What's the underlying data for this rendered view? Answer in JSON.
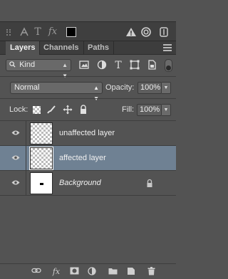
{
  "toolstrip": {
    "icons": [
      "type-warp-icon",
      "type-icon",
      "fx-icon",
      "color-swatch",
      "warning-icon",
      "link-layers-icon",
      "vertical-scroll-icon"
    ],
    "type_glyph": "T",
    "fx_glyph": "fx"
  },
  "tabs": [
    {
      "label": "Layers",
      "active": true
    },
    {
      "label": "Channels",
      "active": false
    },
    {
      "label": "Paths",
      "active": false
    }
  ],
  "filter": {
    "kind_label": "Kind",
    "icons": [
      "pixel-filter-icon",
      "adjustment-filter-icon",
      "type-filter-icon",
      "shape-filter-icon",
      "smart-object-filter-icon"
    ],
    "type_glyph": "T"
  },
  "blend": {
    "mode": "Normal",
    "opacity_label": "Opacity:",
    "opacity_value": "100%"
  },
  "lock": {
    "label": "Lock:",
    "fill_label": "Fill:",
    "fill_value": "100%"
  },
  "layers": [
    {
      "name": "unaffected layer",
      "visible": true,
      "selected": false,
      "italic": false,
      "locked": false
    },
    {
      "name": "affected layer",
      "visible": true,
      "selected": true,
      "italic": false,
      "locked": false
    },
    {
      "name": "Background",
      "visible": true,
      "selected": false,
      "italic": true,
      "locked": true
    }
  ],
  "bottom_icons": [
    "link-icon",
    "fx-icon",
    "mask-icon",
    "adjustment-layer-icon",
    "group-folder-icon",
    "new-layer-icon",
    "trash-icon"
  ],
  "bottom": {
    "fx_glyph": "fx"
  },
  "colors": {
    "panel_bg": "#535353",
    "selected_row": "#6f8193",
    "dark_strip": "#3f3f3f"
  }
}
